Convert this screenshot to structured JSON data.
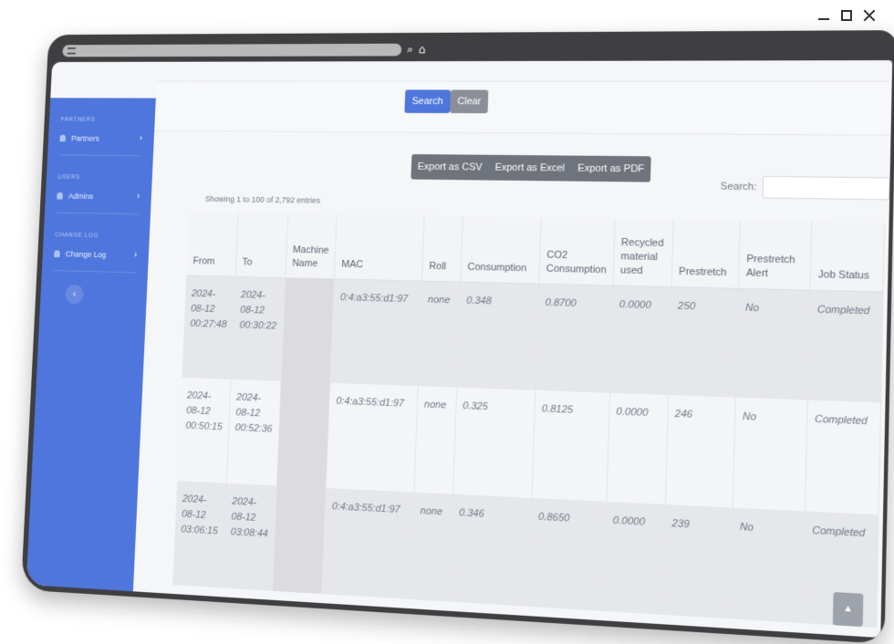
{
  "window": {
    "controls": {
      "minimize_icon": "minimize-icon",
      "maximize_icon": "maximize-icon",
      "close_icon": "close-icon"
    }
  },
  "browser": {
    "url_icon": "tune-icon",
    "search_glyph": "⌕",
    "home_glyph": "⌂"
  },
  "sidebar": {
    "sections": [
      {
        "heading": "PARTNERS",
        "item": "Partners"
      },
      {
        "heading": "USERS",
        "item": "Admins"
      },
      {
        "heading": "CHANGE LOG",
        "item": "Change Log"
      }
    ],
    "chevron": "›",
    "collapse_glyph": "‹"
  },
  "filters": {
    "search_label": "Search",
    "clear_label": "Clear"
  },
  "export": {
    "csv": "Export as CSV",
    "excel": "Export as Excel",
    "pdf": "Export as PDF"
  },
  "table": {
    "showing": "Showing 1 to 100 of 2,792 entries",
    "search_label": "Search:",
    "search_value": "",
    "columns": [
      "From",
      "To",
      "Machine Name",
      "MAC",
      "Roll",
      "Consumption",
      "CO2 Consumption",
      "Recycled material used",
      "Prestretch",
      "Prestretch Alert",
      "Job Status"
    ],
    "rows": [
      [
        "2024-08-12 00:27:48",
        "2024-08-12 00:30:22",
        "",
        "0:4:a3:55:d1:97",
        "none",
        "0.348",
        "0.8700",
        "0.0000",
        "250",
        "No",
        "Completed"
      ],
      [
        "2024-08-12 00:50:15",
        "2024-08-12 00:52:36",
        "",
        "0:4:a3:55:d1:97",
        "none",
        "0.325",
        "0.8125",
        "0.0000",
        "246",
        "No",
        "Completed"
      ],
      [
        "2024-08-12 03:06:15",
        "2024-08-12 03:08:44",
        "",
        "0:4:a3:55:d1:97",
        "none",
        "0.346",
        "0.8650",
        "0.0000",
        "239",
        "No",
        "Completed"
      ]
    ]
  },
  "scroll_top_glyph": "▲",
  "colors": {
    "sidebar": "#4e76dc",
    "search_button": "#4e76dc",
    "clear_button": "#8b8f98",
    "export_group": "#6f737c"
  }
}
